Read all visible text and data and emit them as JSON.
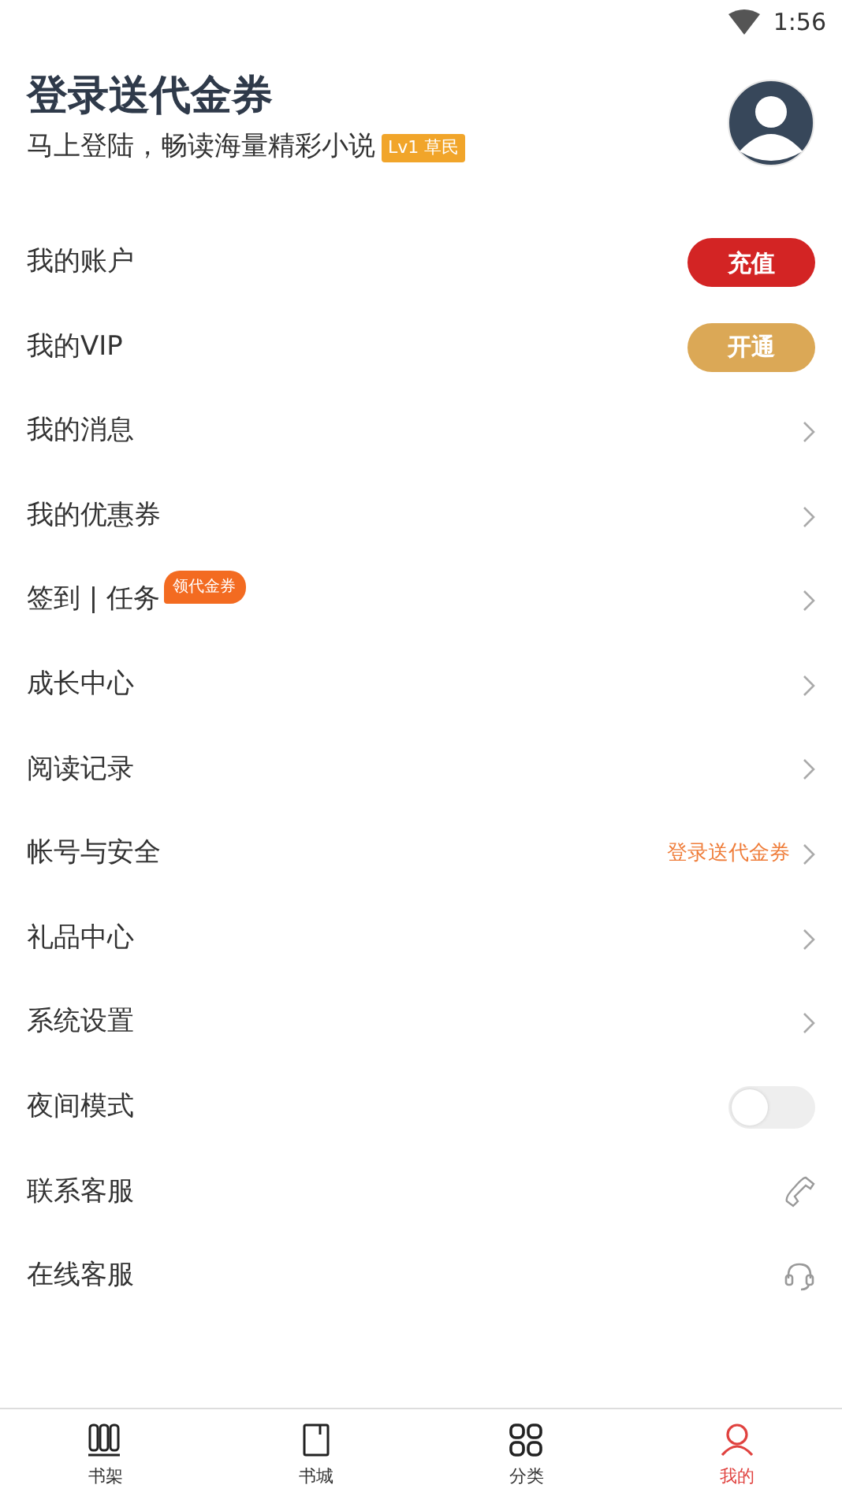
{
  "status_bar": {
    "time": "1:56"
  },
  "header": {
    "title": "登录送代金券",
    "subtitle": "马上登陆，畅读海量精彩小说",
    "level_badge": "Lv1 草民"
  },
  "menu": [
    {
      "kind": "button",
      "label": "我的账户",
      "button": "充值",
      "color": "#d32424"
    },
    {
      "kind": "button",
      "label": "我的VIP",
      "button": "开通",
      "color": "#dba856"
    },
    {
      "kind": "chevron",
      "label": "我的消息"
    },
    {
      "kind": "chevron",
      "label": "我的优惠券"
    },
    {
      "kind": "chevron",
      "label": "签到 | 任务",
      "bubble": "领代金券"
    },
    {
      "kind": "chevron",
      "label": "成长中心"
    },
    {
      "kind": "chevron",
      "label": "阅读记录"
    },
    {
      "kind": "chevron",
      "label": "帐号与安全",
      "hint": "登录送代金券"
    },
    {
      "kind": "chevron",
      "label": "礼品中心"
    },
    {
      "kind": "chevron",
      "label": "系统设置"
    },
    {
      "kind": "toggle",
      "label": "夜间模式",
      "on": false
    },
    {
      "kind": "phone",
      "label": "联系客服"
    },
    {
      "kind": "headset",
      "label": "在线客服"
    }
  ],
  "tabs": [
    {
      "kind": "shelf",
      "label": "书架",
      "selected": false
    },
    {
      "kind": "book",
      "label": "书城",
      "selected": false
    },
    {
      "kind": "grid",
      "label": "分类",
      "selected": false
    },
    {
      "kind": "person",
      "label": "我的",
      "selected": true
    }
  ]
}
